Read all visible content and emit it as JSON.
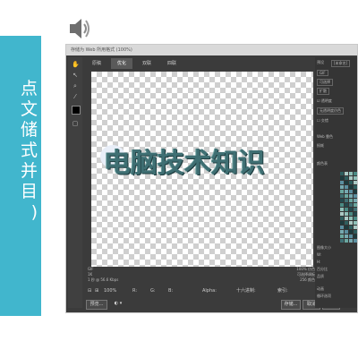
{
  "slide": {
    "lines": [
      "点",
      "文",
      "储",
      "式",
      "并",
      "目",
      ")"
    ]
  },
  "window": {
    "title": "存储为 Web 所用格式 (100%)",
    "tabs": [
      "原稿",
      "优化",
      "双联",
      "四联"
    ],
    "active_tab_index": 1,
    "canvas_text": "电脑技术知识",
    "info_left": [
      "GIF",
      "1K",
      "1 秒 @ 56.6 Kbps"
    ],
    "info_right": [
      "100% 仿色",
      "可选择调板",
      "256 颜色"
    ],
    "bottom": {
      "zoom": "100%",
      "r_label": "R:",
      "g_label": "G:",
      "b_label": "B:",
      "alpha_label": "Alpha:",
      "hex_label": "十六进制:",
      "index_label": "索引:"
    },
    "footer": {
      "preview_button": "预览...",
      "done_button": "完成",
      "cancel_button": "取消",
      "save_button": "存储..."
    }
  },
  "right_panel": {
    "preset_label": "预设",
    "preset_value": "[未命名]",
    "format": "GIF",
    "reduction": "可选择",
    "dither": "扩散",
    "transparency": "透明度",
    "no_transparency_dither": "无透明度仿色",
    "interlaced": "交错",
    "web_snap_label": "Web 靠色",
    "lossy_label": "损耗",
    "color_table_label": "颜色表",
    "image_size_label": "图像大小",
    "w_label": "W:",
    "h_label": "H:",
    "percent_label": "百分比",
    "quality_label": "品质",
    "animation_label": "动画",
    "loop_label": "循环选项"
  },
  "colors": {
    "slide_panel": "#41b6cd",
    "window_bg": "#3b3b3b",
    "text_fill": "#3f6f73"
  }
}
